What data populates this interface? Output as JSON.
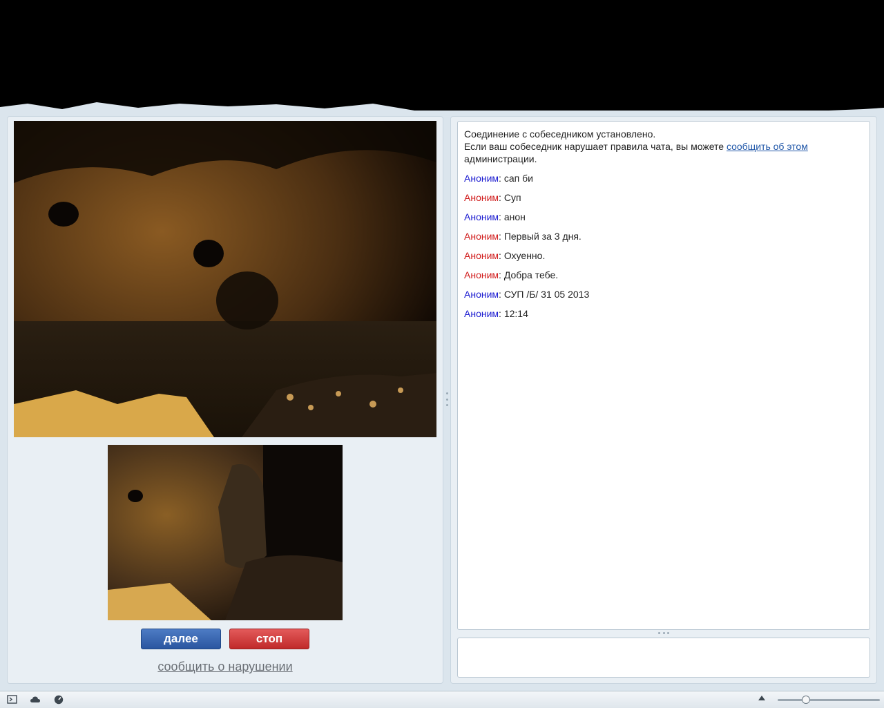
{
  "chat": {
    "system_line1": "Соединение с собеседником установлено.",
    "system_line2_prefix": "Если ваш собеседник нарушает правила чата, вы можете ",
    "system_link": "сообщить об этом",
    "system_line2_suffix": "администрации.",
    "messages": [
      {
        "author": "Аноним",
        "color": "blue",
        "text": "сап би"
      },
      {
        "author": "Аноним",
        "color": "red",
        "text": "Суп"
      },
      {
        "author": "Аноним",
        "color": "blue",
        "text": "анон"
      },
      {
        "author": "Аноним",
        "color": "red",
        "text": "Первый за 3 дня."
      },
      {
        "author": "Аноним",
        "color": "red",
        "text": "Охуенно."
      },
      {
        "author": "Аноним",
        "color": "red",
        "text": "Добра тебе."
      },
      {
        "author": "Аноним",
        "color": "blue",
        "text": "СУП /Б/ 31 05 2013"
      },
      {
        "author": "Аноним",
        "color": "blue",
        "text": "12:14"
      }
    ]
  },
  "controls": {
    "next_label": "далее",
    "stop_label": "стоп",
    "report_label": "сообщить о нарушении"
  },
  "colors": {
    "author_blue": "#1a1ad0",
    "author_red": "#d01a1a",
    "next_button": "#2f5da8",
    "stop_button": "#cc3333"
  },
  "statusbar": {
    "icons": [
      "terminal-icon",
      "cloud-icon",
      "speed-gauge-icon"
    ],
    "zoom_fraction": 0.28
  }
}
